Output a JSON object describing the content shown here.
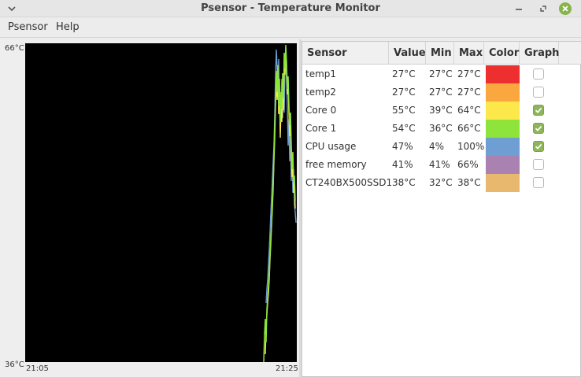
{
  "window": {
    "title": "Psensor - Temperature Monitor"
  },
  "menubar": {
    "items": [
      "Psensor",
      "Help"
    ]
  },
  "graph": {
    "y_max_label": "66°C",
    "y_min_label": "36°C",
    "x_start_label": "21:05",
    "x_end_label": "21:25",
    "background": "#000000"
  },
  "table": {
    "headers": {
      "sensor": "Sensor",
      "value": "Value",
      "min": "Min",
      "max": "Max",
      "color": "Color",
      "graph": "Graph"
    },
    "rows": [
      {
        "sensor": "temp1",
        "value": "27°C",
        "min": "27°C",
        "max": "27°C",
        "color": "#ee2f2f",
        "graph": false
      },
      {
        "sensor": "temp2",
        "value": "27°C",
        "min": "27°C",
        "max": "27°C",
        "color": "#fba73f",
        "graph": false
      },
      {
        "sensor": "Core 0",
        "value": "55°C",
        "min": "39°C",
        "max": "64°C",
        "color": "#fce84a",
        "graph": true
      },
      {
        "sensor": "Core 1",
        "value": "54°C",
        "min": "36°C",
        "max": "66°C",
        "color": "#8ee43a",
        "graph": true
      },
      {
        "sensor": "CPU usage",
        "value": "47%",
        "min": "4%",
        "max": "100%",
        "color": "#6f9ed3",
        "graph": true
      },
      {
        "sensor": "free memory",
        "value": "41%",
        "min": "41%",
        "max": "66%",
        "color": "#a982b1",
        "graph": false
      },
      {
        "sensor": "CT240BX500SSD1",
        "value": "38°C",
        "min": "32°C",
        "max": "38°C",
        "color": "#e8b86f",
        "graph": false
      }
    ]
  },
  "icons": {
    "window_menu": "chevron-down-icon",
    "minimize": "minimize-icon",
    "maximize": "maximize-icon",
    "close": "close-icon",
    "checkbox_checked": "check-icon"
  }
}
